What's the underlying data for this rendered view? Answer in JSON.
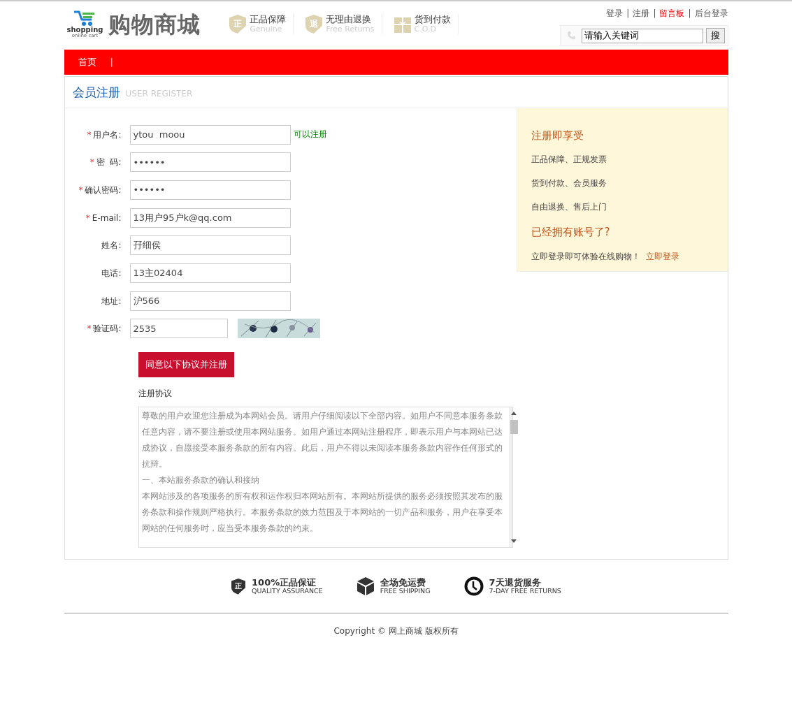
{
  "logo": {
    "brand": "shopping",
    "tagline": "online cart",
    "title": "购物商城"
  },
  "guarantees": [
    {
      "kind": "shield",
      "glyph": "正",
      "title": "正品保障",
      "subtitle": "Genuine"
    },
    {
      "kind": "shield",
      "glyph": "退",
      "title": "无理由退换",
      "subtitle": "Free Returns"
    },
    {
      "kind": "gift",
      "title": "货到付款",
      "subtitle": "C.O.D"
    }
  ],
  "top_links_separator": "|",
  "top_links": [
    {
      "label": "登录",
      "highlight": false
    },
    {
      "label": "注册",
      "highlight": false
    },
    {
      "label": "留言板",
      "highlight": true
    },
    {
      "label": "后台登录",
      "highlight": false
    }
  ],
  "search": {
    "value": "请输入关键词",
    "button": "搜"
  },
  "nav": {
    "items": [
      {
        "label": "首页"
      }
    ],
    "separator": "|"
  },
  "panel": {
    "title": "会员注册",
    "subtitle": "USER REGISTER"
  },
  "form": {
    "required_mark": "*",
    "fields": [
      {
        "label": "用户名:",
        "required": true,
        "kind": "text",
        "value": "ytou  moou",
        "hint": "可以注册"
      },
      {
        "label": "密  码:",
        "required": true,
        "kind": "password",
        "value": "••••••"
      },
      {
        "label": "确认密码:",
        "required": true,
        "kind": "password",
        "value": "••••••"
      },
      {
        "label": "E-mail:",
        "required": true,
        "kind": "text",
        "value": "13用户95户k@qq.com"
      },
      {
        "label": "姓名:",
        "required": false,
        "kind": "text",
        "value": "孖细侯"
      },
      {
        "label": "电话:",
        "required": false,
        "kind": "text",
        "value": "13主02404"
      },
      {
        "label": "地址:",
        "required": false,
        "kind": "text",
        "value": "沪566"
      },
      {
        "label": "验证码:",
        "required": true,
        "kind": "captcha",
        "value": "2535"
      }
    ],
    "submit": "同意以下协议并注册",
    "agreement_title": "注册协议",
    "agreement": [
      "尊敬的用户欢迎您注册成为本网站会员。请用户仔细阅读以下全部内容。如用户不同意本服务条款任意内容，请不要注册或使用本网站服务。如用户通过本网站注册程序，即表示用户与本网站已达成协议，自愿接受本服务条款的所有内容。此后，用户不得以未阅读本服务条款内容作任何形式的抗辩。",
      "一、本站服务条款的确认和接纳",
      "本网站涉及的各项服务的所有权和运作权归本网站所有。本网站所提供的服务必须按照其发布的服务条款和操作规则严格执行。本服务条款的效力范围及于本网站的一切产品和服务，用户在享受本网站的任何服务时，应当受本服务条款的约束。"
    ]
  },
  "sidebar": {
    "benefits_title": "注册即享受",
    "benefits": [
      "正品保障、正规发票",
      "货到付款、会员服务",
      "自由退换、售后上门"
    ],
    "login_title": "已经拥有账号了?",
    "login_text": "立即登录即可体验在线购物！",
    "login_link": "立即登录"
  },
  "footer": {
    "features": [
      {
        "kind": "shield",
        "glyph": "正",
        "title": "100%正品保证",
        "subtitle": "QUALITY ASSURANCE"
      },
      {
        "kind": "box",
        "title": "全场免运费",
        "subtitle": "FREE SHIPPING"
      },
      {
        "kind": "clock",
        "title": "7天退货服务",
        "subtitle": "7-DAY FREE RETURNS"
      }
    ],
    "copyright": "Copyright © 网上商城 版权所有"
  }
}
